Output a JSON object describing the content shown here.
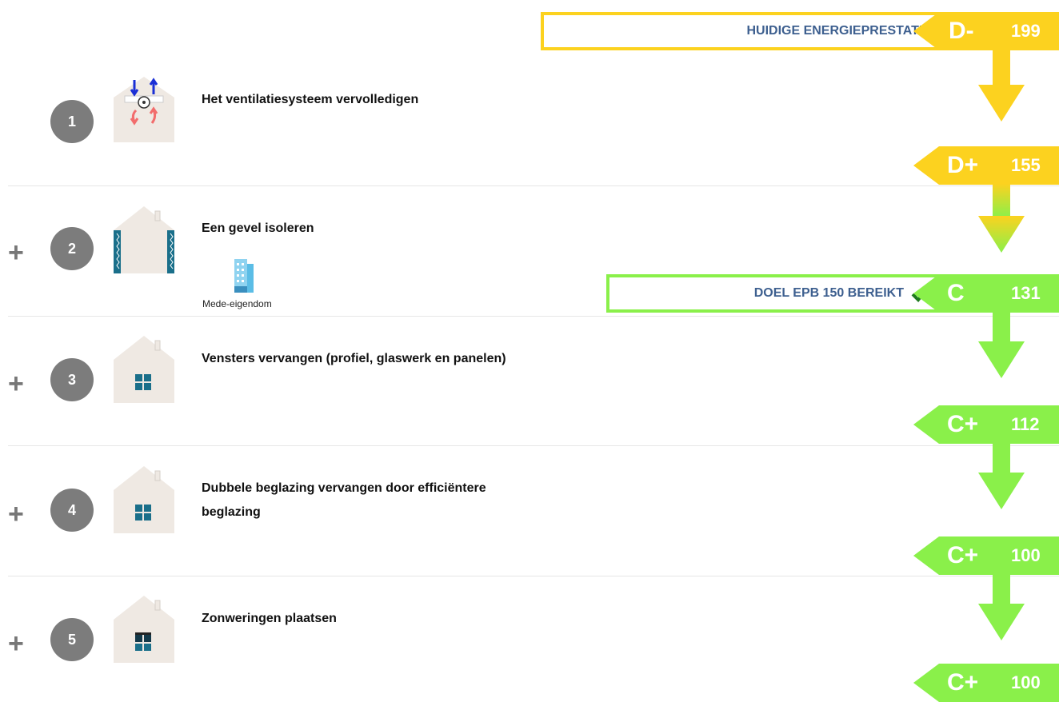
{
  "current": {
    "label": "HUIDIGE ENERGIEPRESTATIE",
    "class": "D-",
    "value": "199",
    "color": "#fcd21f"
  },
  "goal": {
    "label": "DOEL EPB 150 BEREIKT",
    "check_icon": "checkmark-icon",
    "class": "C",
    "value": "131",
    "color": "#8af04a"
  },
  "steps": [
    {
      "number": "1",
      "title": "Het ventilatiesysteem vervolledigen",
      "icon": "ventilation-house-icon"
    },
    {
      "number": "2",
      "title": "Een gevel isoleren",
      "icon": "insulated-wall-house-icon",
      "tag": "Mede-eigendom",
      "tag_icon": "building-icon"
    },
    {
      "number": "3",
      "title": "Vensters vervangen (profiel, glaswerk en panelen)",
      "icon": "window-house-icon"
    },
    {
      "number": "4",
      "title": "Dubbele beglazing vervangen door efficiëntere beglazing",
      "title_line1": "Dubbele beglazing vervangen door efficiëntere",
      "title_line2": "beglazing",
      "icon": "window-house-icon"
    },
    {
      "number": "5",
      "title": "Zonweringen plaatsen",
      "icon": "shaded-window-house-icon"
    }
  ],
  "plus_sign": "+",
  "levels": [
    {
      "class": "D+",
      "value": "155",
      "color": "#fcd21f"
    },
    {
      "class": "C+",
      "value": "112",
      "color": "#8af04a"
    },
    {
      "class": "C+",
      "value": "100",
      "color": "#8af04a"
    },
    {
      "class": "C+",
      "value": "100",
      "color": "#8af04a"
    }
  ],
  "colors": {
    "yellow": "#fcd21f",
    "green": "#8af04a",
    "step_circle": "#7c7c7c",
    "banner_text": "#3d5f8f",
    "house": "#efe9e3",
    "window": "#1a6f8a"
  }
}
